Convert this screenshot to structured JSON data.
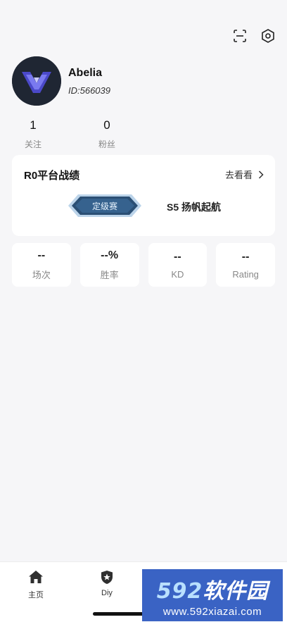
{
  "profile": {
    "username": "Abelia",
    "user_id": "ID:566039"
  },
  "stats": {
    "following_count": "1",
    "following_label": "关注",
    "fans_count": "0",
    "fans_label": "粉丝"
  },
  "record": {
    "title": "R0平台战绩",
    "link_label": "去看看",
    "rank_badge": "定级赛",
    "season": "S5  扬帆起航"
  },
  "metrics": [
    {
      "value": "--",
      "label": "场次"
    },
    {
      "value": "--%",
      "label": "胜率"
    },
    {
      "value": "--",
      "label": "KD"
    },
    {
      "value": "--",
      "label": "Rating"
    }
  ],
  "tabbar": {
    "items": [
      {
        "label": "主页",
        "icon": "home-icon"
      },
      {
        "label": "Diy",
        "icon": "shield-star-icon"
      },
      {
        "label": "",
        "icon": "mail-icon"
      },
      {
        "label": "",
        "icon": "person-icon"
      }
    ]
  },
  "watermark": {
    "digits": "592",
    "brand": "软件园",
    "url": "www.592xiazai.com"
  },
  "colors": {
    "background": "#f6f6f8",
    "card": "#ffffff",
    "badge": "#2b4f74",
    "watermark": "#3a63c4"
  }
}
